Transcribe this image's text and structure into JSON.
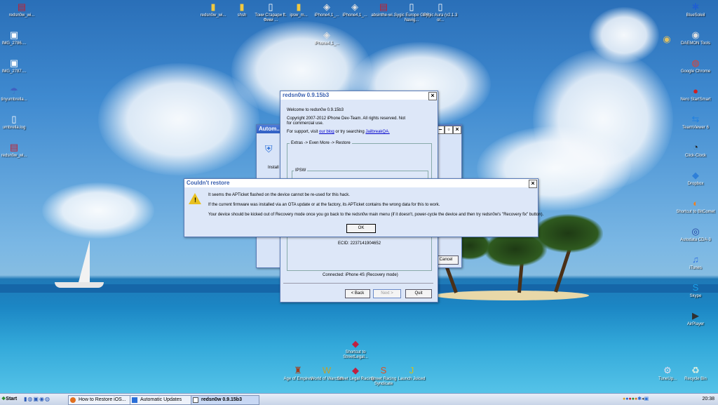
{
  "desktop": {
    "icons_top": [
      {
        "label": "redsn0w_wi...",
        "icon": "folder-icon",
        "glyph": "▤",
        "color": "#c02030"
      },
      {
        "label": "redsn0w_wi...",
        "icon": "folder-icon",
        "glyph": "▮",
        "color": "#f0c840"
      },
      {
        "label": "shsh",
        "icon": "folder-icon",
        "glyph": "▮",
        "color": "#f0c840"
      },
      {
        "label": "Тони Старари ft. Фики ...",
        "icon": "document-icon",
        "glyph": "▯",
        "color": "#ffffff"
      },
      {
        "label": "ipsw_m...",
        "icon": "folder-icon",
        "glyph": "▮",
        "color": "#f0c840"
      },
      {
        "label": "iPhone4,1_...",
        "icon": "cube-icon",
        "glyph": "◈",
        "color": "#e0e0e0"
      },
      {
        "label": "iPhone4,1_...",
        "icon": "cube-icon",
        "glyph": "◈",
        "color": "#e0e0e0"
      },
      {
        "label": "absinthe-wi...",
        "icon": "rar-archive-icon",
        "glyph": "▤",
        "color": "#c02030"
      },
      {
        "label": "Sygic Europe GPS Navig...",
        "icon": "document-icon",
        "glyph": "▯",
        "color": "#ffffff"
      },
      {
        "label": "Sygic Aura (v2.1.3 or...",
        "icon": "document-icon",
        "glyph": "▯",
        "color": "#ffffff"
      },
      {
        "label": "iPhone4,1_...",
        "icon": "cube-icon",
        "glyph": "◈",
        "color": "#e0e0e0"
      }
    ],
    "icons_left": [
      {
        "label": "IMG_2786....",
        "icon": "image-icon",
        "glyph": "▣",
        "color": "#ffffff"
      },
      {
        "label": "IMG_2787....",
        "icon": "image-icon",
        "glyph": "▣",
        "color": "#ffffff"
      },
      {
        "label": "tinyumbrella...",
        "icon": "umbrella-icon",
        "glyph": "☂",
        "color": "#4060c0"
      },
      {
        "label": "umbrella.log",
        "icon": "text-file-icon",
        "glyph": "▯",
        "color": "#ffffff"
      },
      {
        "label": "redsn0w_wi...",
        "icon": "rar-archive-icon",
        "glyph": "▤",
        "color": "#c02030"
      }
    ],
    "icons_right": [
      {
        "label": "BlueSoleil",
        "icon": "bluetooth-icon",
        "glyph": "✱",
        "color": "#2060d0"
      },
      {
        "label": "DAEMON Tools",
        "icon": "daemon-tools-icon",
        "glyph": "◉",
        "color": "#e0e0e0"
      },
      {
        "label": "Google Chrome",
        "icon": "chrome-icon",
        "glyph": "◍",
        "color": "#e04030"
      },
      {
        "label": "Nero StartSmart",
        "icon": "nero-icon",
        "glyph": "●",
        "color": "#d02020"
      },
      {
        "label": "TeamViewer 6",
        "icon": "teamviewer-icon",
        "glyph": "⇆",
        "color": "#2080e0"
      },
      {
        "label": "Click-Clock",
        "icon": "clock-icon",
        "glyph": "◔",
        "color": "#202020"
      },
      {
        "label": "Dropbox",
        "icon": "dropbox-icon",
        "glyph": "◆",
        "color": "#2f7fd8"
      },
      {
        "label": "Shortcut to BitComet",
        "icon": "bitcomet-icon",
        "glyph": "◐",
        "color": "#f08020"
      },
      {
        "label": "Autodata CDA-3",
        "icon": "autodata-icon",
        "glyph": "◎",
        "color": "#2040a0"
      },
      {
        "label": "iTunes",
        "icon": "itunes-icon",
        "glyph": "♫",
        "color": "#3070e0"
      },
      {
        "label": "Skype",
        "icon": "skype-icon",
        "glyph": "S",
        "color": "#1aa0e8"
      },
      {
        "label": "AirPlayer",
        "icon": "airplayer-icon",
        "glyph": "▶",
        "color": "#303030"
      }
    ],
    "icons_bottom": [
      {
        "label": "Shortcut to StreetLegal...",
        "icon": "car-icon",
        "glyph": "◆",
        "color": "#c02040"
      },
      {
        "label": "Age of Empires",
        "icon": "game-icon",
        "glyph": "♜",
        "color": "#a04020"
      },
      {
        "label": "World of Warcraft",
        "icon": "game-icon",
        "glyph": "W",
        "color": "#c0a030"
      },
      {
        "label": "Street Legal Racing",
        "icon": "car-icon",
        "glyph": "◆",
        "color": "#c02040"
      },
      {
        "label": "Street Racing Syndicate",
        "icon": "game-icon",
        "glyph": "S",
        "color": "#e05020"
      },
      {
        "label": "Launch Juiced",
        "icon": "game-icon",
        "glyph": "J",
        "color": "#d0c020"
      },
      {
        "label": "TuneUp...",
        "icon": "tuneup-icon",
        "glyph": "⚙",
        "color": "#e0e0f0"
      },
      {
        "label": "Recycle Bin",
        "icon": "recycle-bin-icon",
        "glyph": "♻",
        "color": "#e0f0e0"
      }
    ]
  },
  "back_window": {
    "title": "Autom...",
    "install_label": "Install",
    "cancel_label": "Cancel"
  },
  "redsnow_window": {
    "title": "redsn0w 0.9.15b3",
    "welcome": "Welcome to redsn0w 0.9.15b3",
    "copyright": "Copyright 2007-2012 iPhone Dev-Team. All rights reserved. Not for commercial use.",
    "support_prefix": "For support, visit ",
    "support_link": "our blog",
    "support_mid": " or try searching ",
    "support_link2": "JailbreakQA.",
    "breadcrumb": "Extras -> Even More -> Restore",
    "ipsw_label": "IPSW",
    "ecid": "ECID: 2237141904652",
    "connected": "Connected: iPhone 4S (Recovery mode)",
    "back_label": "< Back",
    "next_label": "Next >",
    "quit_label": "Quit"
  },
  "error_dialog": {
    "title": "Couldn't restore",
    "line1": "It seems the APTicket flashed on the device cannot be re-used for this hack.",
    "line2": "If the current firmware was installed via an OTA update or at the factory, its APTicket contains the wrong data for this to work.",
    "line3": "Your device should be kicked out of Recovery mode once you go back to the redsn0w main menu (if it doesn't, power-cycle the device and then try redsn0w's \"Recovery fix\" button).",
    "ok_label": "OK"
  },
  "taskbar": {
    "start_label": "Start",
    "tasks": [
      {
        "label": "How to Restore iOS...",
        "icon": "firefox-icon"
      },
      {
        "label": "Automatic Updates",
        "icon": "update-icon"
      },
      {
        "label": "redsn0w 0.9.15b3",
        "icon": "redsnow-icon"
      }
    ],
    "clock": "20:38"
  }
}
